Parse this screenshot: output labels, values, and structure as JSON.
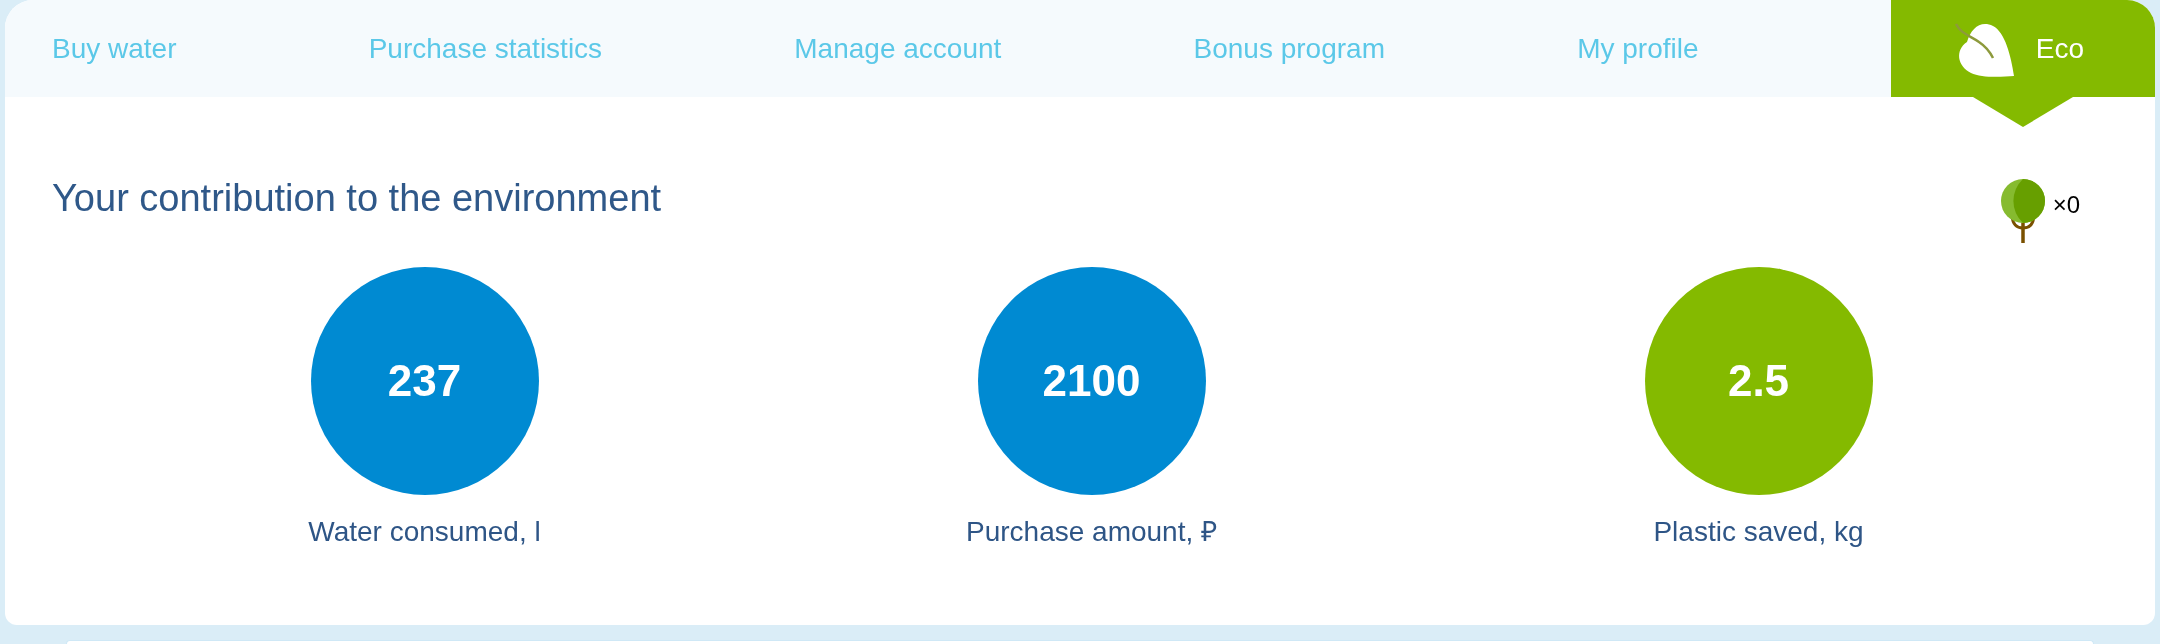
{
  "tabs": [
    {
      "label": "Buy water",
      "selected": false,
      "kind": "plain"
    },
    {
      "label": "Purchase statistics",
      "selected": false,
      "kind": "plain"
    },
    {
      "label": "Manage account",
      "selected": false,
      "kind": "plain"
    },
    {
      "label": "Bonus program",
      "selected": false,
      "kind": "plain"
    },
    {
      "label": "My profile",
      "selected": false,
      "kind": "plain"
    },
    {
      "label": "Eco",
      "selected": true,
      "kind": "icon"
    }
  ],
  "title": "Your contribution to the environment",
  "tree_counter": {
    "count": "×0"
  },
  "stats": [
    {
      "value": "237",
      "label": "Water consumed, l",
      "color": "#008ad2"
    },
    {
      "value": "2100",
      "label": "Purchase amount, ₽",
      "color": "#008ad2"
    },
    {
      "value": "2.5",
      "label": "Plastic saved, kg",
      "color": "#84ba00"
    }
  ]
}
